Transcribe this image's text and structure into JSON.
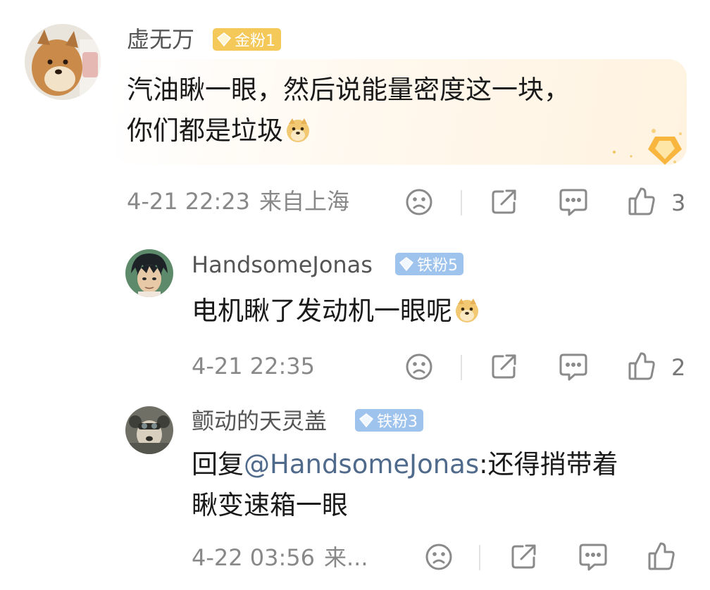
{
  "comments": [
    {
      "username": "虚无万",
      "badge": "金粉1",
      "text_lines": [
        "汽油瞅一眼，然后说能量密度这一块，",
        "你们都是垃圾"
      ],
      "timestamp": "4-21 22:23",
      "location": "来自上海",
      "like_count": "3"
    },
    {
      "username": "HandsomeJonas",
      "badge": "铁粉5",
      "text_lines": [
        "电机瞅了发动机一眼呢"
      ],
      "timestamp": "4-21 22:35",
      "like_count": "2"
    },
    {
      "username": "颤动的天灵盖",
      "badge": "铁粉3",
      "reply_prefix": "回复",
      "mention": "@HandsomeJonas",
      "reply_rest": ":还得捎带着",
      "text_line2": "瞅变速箱一眼",
      "timestamp": "4-22 03:56",
      "location_truncated": "来..."
    }
  ],
  "icons": {
    "dislike": "sad-face-icon",
    "share": "share-icon",
    "comment": "comment-icon",
    "like": "thumbs-up-icon",
    "emoji": "doge-emoji"
  },
  "colors": {
    "gold_badge": "#f5c85a",
    "iron_badge": "#9ec3ec",
    "mention": "#506a8c",
    "meta_text": "#888888",
    "icon_stroke": "#8a8a8a"
  }
}
